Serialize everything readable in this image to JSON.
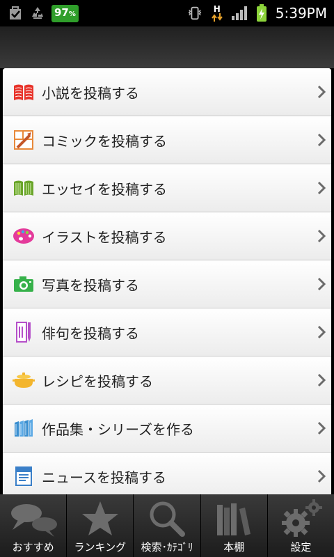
{
  "status_bar": {
    "battery_percent": "97",
    "battery_unit": "%",
    "network_type": "H",
    "time": "5:39PM",
    "icons": [
      "checkbox-bag-icon",
      "recycle-icon",
      "battery-badge",
      "vibrate-icon",
      "data-arrows-icon",
      "signal-icon",
      "battery-charging-icon"
    ]
  },
  "menu": {
    "items": [
      {
        "label": "小説を投稿する",
        "icon": "book-icon",
        "color": "#e8332a"
      },
      {
        "label": "コミックを投稿する",
        "icon": "comic-icon",
        "color": "#e8893a"
      },
      {
        "label": "エッセイを投稿する",
        "icon": "essay-book-icon",
        "color": "#6aa52a"
      },
      {
        "label": "イラストを投稿する",
        "icon": "palette-icon",
        "color": "#e43a9b"
      },
      {
        "label": "写真を投稿する",
        "icon": "camera-icon",
        "color": "#36b14a"
      },
      {
        "label": "俳句を投稿する",
        "icon": "haiku-brush-icon",
        "color": "#b54fc9"
      },
      {
        "label": "レシピを投稿する",
        "icon": "cooking-pot-icon",
        "color": "#f3b52d"
      },
      {
        "label": "作品集・シリーズを作る",
        "icon": "books-shelf-icon",
        "color": "#3a8fd0"
      },
      {
        "label": "ニュースを投稿する",
        "icon": "news-icon",
        "color": "#3a7fc8"
      }
    ]
  },
  "tabs": [
    {
      "label": "おすすめ",
      "icon": "speech-bubbles-icon"
    },
    {
      "label": "ランキング",
      "icon": "star-icon"
    },
    {
      "label": "検索･ｶﾃｺﾞﾘ",
      "icon": "magnifier-icon"
    },
    {
      "label": "本棚",
      "icon": "bookshelf-icon"
    },
    {
      "label": "設定",
      "icon": "gear-icon"
    }
  ]
}
